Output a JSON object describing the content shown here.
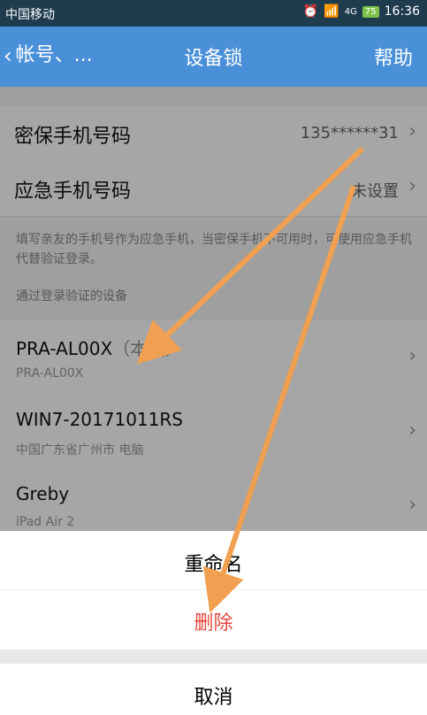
{
  "statusbar": {
    "carrier": "中国移动",
    "battery": "75",
    "time": "16:36",
    "network": "4G"
  },
  "navbar": {
    "back_label": "帐号、...",
    "title": "设备锁",
    "help": "帮助"
  },
  "rows": {
    "security_phone": {
      "label": "密保手机号码",
      "value": "135******31"
    },
    "emergency_phone": {
      "label": "应急手机号码",
      "value": "未设置"
    }
  },
  "note": "填写亲友的手机号作为应急手机，当密保手机不可用时，可使用应急手机代替验证登录。",
  "devices_header": "通过登录验证的设备",
  "devices": [
    {
      "name": "PRA-AL00X",
      "tag": "（本机）",
      "sub": "PRA-AL00X"
    },
    {
      "name": "WIN7-20171011RS",
      "sub": "中国广东省广州市 电脑"
    },
    {
      "name": "Greby",
      "sub": "iPad Air 2"
    }
  ],
  "sheet": {
    "rename": "重命名",
    "delete": "删除",
    "cancel": "取消"
  },
  "colors": {
    "navbar": "#4a90d9",
    "delete": "#e8453c",
    "arrow": "#f0a050"
  }
}
